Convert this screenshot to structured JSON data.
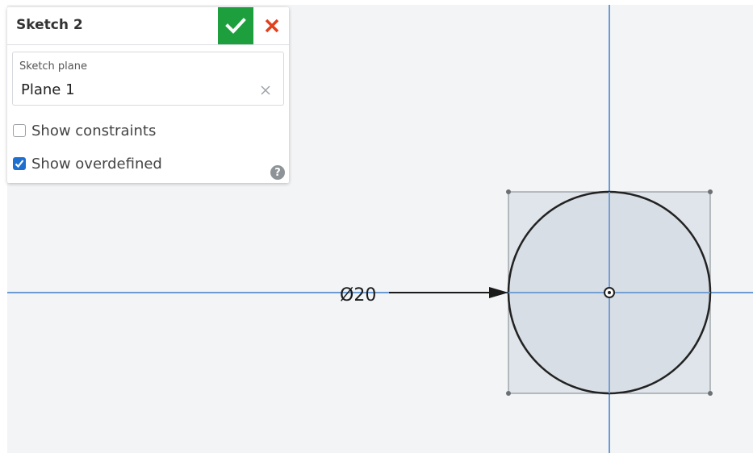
{
  "panel": {
    "title": "Sketch 2",
    "accept_icon": "checkmark-icon",
    "cancel_icon": "close-x-icon",
    "sketch_plane": {
      "label": "Sketch plane",
      "value": "Plane 1",
      "clear_icon": "clear-x-icon"
    },
    "options": [
      {
        "label": "Show constraints",
        "checked": false
      },
      {
        "label": "Show overdefined",
        "checked": true
      }
    ],
    "help_icon": "help-question-icon",
    "help_glyph": "?"
  },
  "canvas": {
    "dimension_label": "Ø20",
    "colors": {
      "background": "#f2f4f6",
      "axis": "#6c9bd2",
      "geometry": "#222222",
      "fill": "#d2d9e1",
      "box": "#7d8388",
      "accept": "#1c9f3c",
      "cancel": "#e2401c",
      "checkbox": "#1f6fd1"
    }
  }
}
